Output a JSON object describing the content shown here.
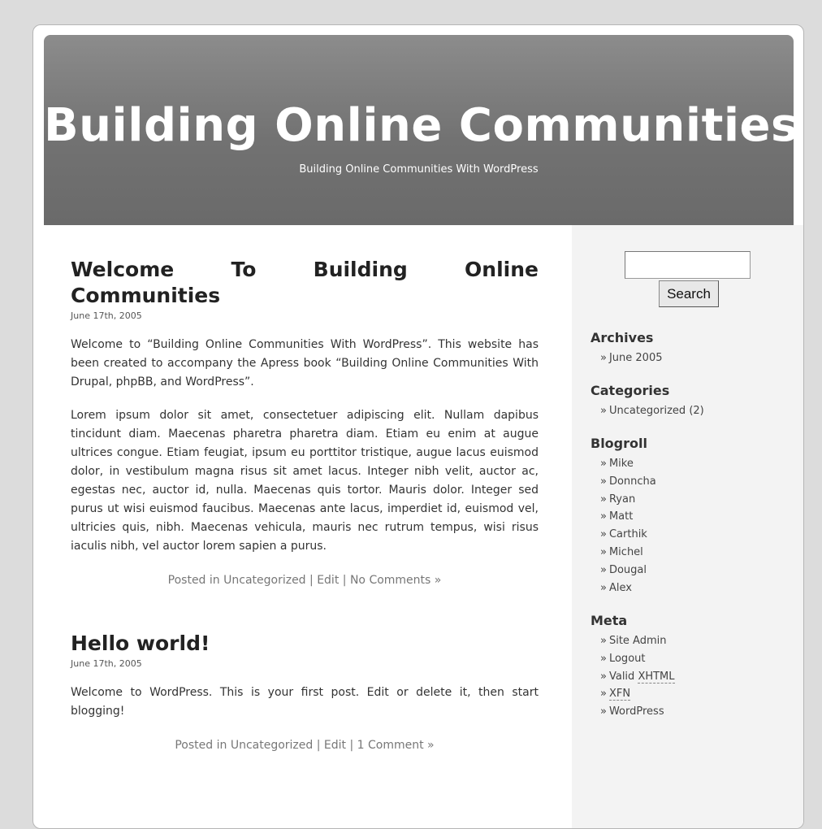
{
  "header": {
    "title": "Building Online Communities",
    "description": "Building Online Communities With WordPress"
  },
  "posts": [
    {
      "title": "Welcome To Building Online Communities",
      "date": "June 17th, 2005",
      "paragraphs": [
        "Welcome to “Building Online Communities With WordPress”. This website has been created to accompany the Apress book “Building Online Communities With Drupal, phpBB, and WordPress”.",
        "Lorem ipsum dolor sit amet, consectetuer adipiscing elit. Nullam dapibus tincidunt diam. Maecenas pharetra pharetra diam. Etiam eu enim at augue ultrices congue. Etiam feugiat, ipsum eu porttitor tristique, augue lacus euismod dolor, in vestibulum magna risus sit amet lacus. Integer nibh velit, auctor ac, egestas nec, auctor id, nulla. Maecenas quis tortor. Mauris dolor. Integer sed purus ut wisi euismod faucibus. Maecenas ante lacus, imperdiet id, euismod vel, ultricies quis, nibh. Maecenas vehicula, mauris nec rutrum tempus, wisi risus iaculis nibh, vel auctor lorem sapien a purus."
      ],
      "meta": {
        "posted_in": "Posted in",
        "category": "Uncategorized",
        "sep1": "|",
        "edit": "Edit",
        "sep2": "|",
        "comments": "No Comments »"
      }
    },
    {
      "title": "Hello world!",
      "date": "June 17th, 2005",
      "paragraphs": [
        "Welcome to WordPress. This is your first post. Edit or delete it, then start blogging!"
      ],
      "meta": {
        "posted_in": "Posted in",
        "category": "Uncategorized",
        "sep1": "|",
        "edit": "Edit",
        "sep2": "|",
        "comments": "1 Comment »"
      }
    }
  ],
  "sidebar": {
    "search": {
      "value": "",
      "button": "Search"
    },
    "bullet": "»",
    "archives": {
      "title": "Archives",
      "items": [
        "June 2005"
      ]
    },
    "categories": {
      "title": "Categories",
      "items": [
        {
          "name": "Uncategorized",
          "count": "(2)"
        }
      ]
    },
    "blogroll": {
      "title": "Blogroll",
      "items": [
        "Mike",
        "Donncha",
        "Ryan",
        "Matt",
        "Carthik",
        "Michel",
        "Dougal",
        "Alex"
      ]
    },
    "meta": {
      "title": "Meta",
      "site_admin": "Site Admin",
      "logout": "Logout",
      "valid_prefix": "Valid",
      "xhtml": "XHTML",
      "xfn": "XFN",
      "wordpress": "WordPress"
    }
  }
}
